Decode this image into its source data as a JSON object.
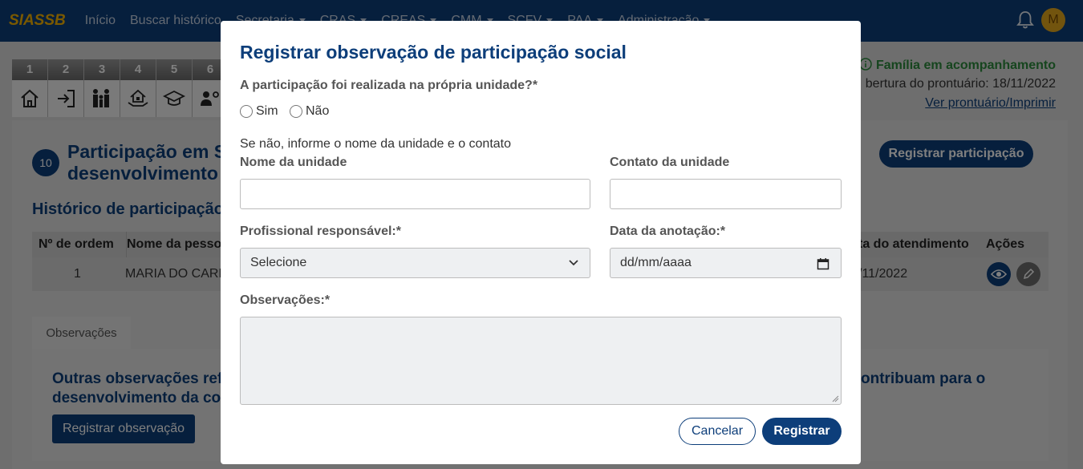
{
  "nav": {
    "brand": "SIASSB",
    "items": [
      {
        "label": "Início",
        "dropdown": false
      },
      {
        "label": "Buscar histórico",
        "dropdown": false
      },
      {
        "label": "Secretaria",
        "dropdown": true
      },
      {
        "label": "CRAS",
        "dropdown": true
      },
      {
        "label": "CREAS",
        "dropdown": true
      },
      {
        "label": "CMM",
        "dropdown": true
      },
      {
        "label": "SCFV",
        "dropdown": true
      },
      {
        "label": "PAA",
        "dropdown": true
      },
      {
        "label": "Administração",
        "dropdown": true
      }
    ],
    "avatar_initial": "M"
  },
  "steps": [
    {
      "num": "1",
      "icon": "home-icon"
    },
    {
      "num": "2",
      "icon": "login-icon"
    },
    {
      "num": "3",
      "icon": "family-icon"
    },
    {
      "num": "4",
      "icon": "house-hands-icon"
    },
    {
      "num": "5",
      "icon": "graduation-cap-icon"
    },
    {
      "num": "6",
      "icon": "people-gear-icon"
    }
  ],
  "status": {
    "family": "Família em acompanhamento",
    "opening": "bertura do prontuário: 18/11/2022",
    "link": "Ver prontuário/Imprimir"
  },
  "section": {
    "number": "10",
    "title_line1": "Participação em S",
    "title_line2": "desenvolvimento",
    "history_title": "Histórico de participação",
    "register_button": "Registrar participação"
  },
  "table": {
    "headers": {
      "order": "Nº de ordem",
      "name": "Nome da pessoa",
      "date": "ta do atendimento",
      "actions": "Ações"
    },
    "rows": [
      {
        "order": "1",
        "name": "MARIA DO CARM",
        "date": "/11/2022"
      }
    ]
  },
  "observations": {
    "tab": "Observações",
    "text_left_1": "Outras observações ref",
    "text_left_2": "desenvolvimento da co",
    "text_right": "ontribuam para o",
    "button": "Registrar observação"
  },
  "modal": {
    "title": "Registrar observação de participação social",
    "question": "A participação foi realizada na própria unidade?*",
    "options": [
      "Sim",
      "Não"
    ],
    "hint": "Se não, informe o nome da unidade e o contato",
    "unit_name_label": "Nome da unidade",
    "unit_contact_label": "Contato da unidade",
    "professional_label": "Profissional responsável:*",
    "professional_value": "Selecione",
    "date_label": "Data da anotação:*",
    "date_placeholder": "dd/mm/aaaa",
    "notes_label": "Observações:*",
    "cancel": "Cancelar",
    "submit": "Registrar"
  }
}
